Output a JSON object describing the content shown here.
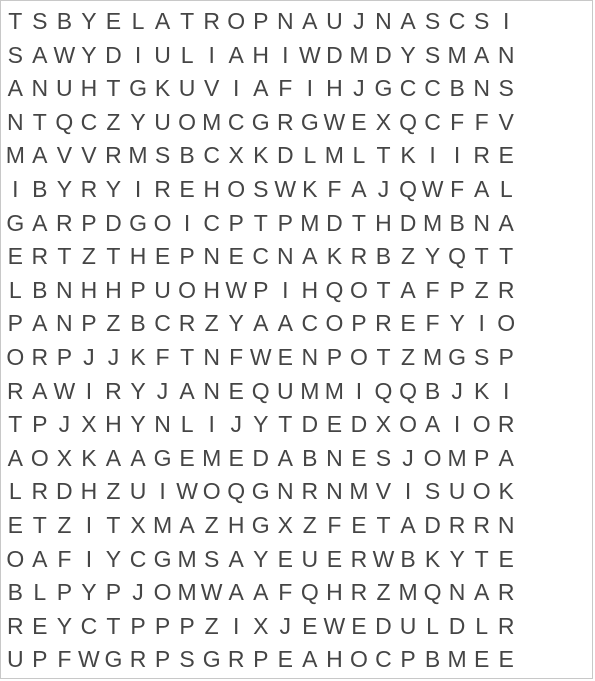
{
  "puzzle": {
    "rows": [
      "TSBYELATROPNAUJNASCSI",
      "SAWYDIULIAHIWDMDYSMAN",
      "ANUHTGKUVIAFIHJGCCBNS",
      "NTQCZYUOMCGRGWEXQCFFV",
      "MAVVRMSBCXKDLMLTKIIRE",
      "IBYRYIREHOSWKFAJQWFAL",
      "GARPDGOICPTPMDTHDMBNA",
      "ERTZTHEPNECNAKRBZYQTT",
      "LBNHHPUOHWPIHQOTAFPZR",
      "PANPZBCRZYAACOPREFYIO",
      "ORPJJKFTNFWENPOTZMGSP",
      "RAWIRYJANEQUMMIQQBJKI",
      "TPJXHYNLIJYTDEDXOAIOR",
      "AOXKAAGEMEDABNESJOMPA",
      "LRDHZUIWOQGNRNMVISUOK",
      "ETZITXMAZHGXZFETADRRN",
      "OAFIYCGMSAYEUERWBKYTE",
      "BLPYPJOMWAAFQHRZMQNAR",
      "REYCTPPPZIXJEWEDULDLR",
      "UPFWGRPSGRPEAHOCPBMEE"
    ]
  }
}
